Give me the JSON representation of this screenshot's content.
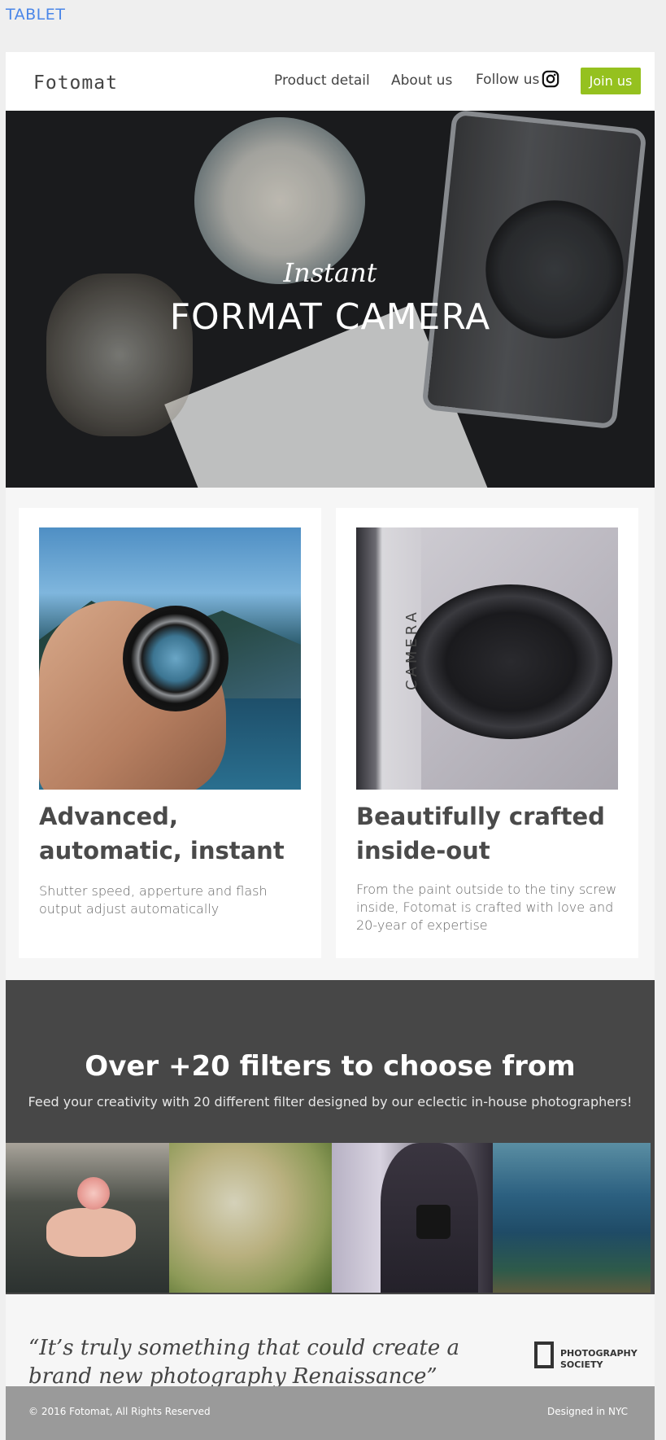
{
  "page_label": "TABLET",
  "header": {
    "logo": "Fotomat",
    "nav": {
      "product": "Product detail",
      "about": "About us",
      "follow": "Follow us"
    },
    "social_icon": "instagram-icon",
    "join_label": "Join us",
    "join_color": "#95c11f"
  },
  "hero": {
    "subtitle": "Instant",
    "title": "FORMAT CAMERA"
  },
  "features": [
    {
      "title": "Advanced, automatic, instant",
      "text": "Shutter speed, apperture and flash output adjust automatically"
    },
    {
      "title": "Beautifully crafted inside-out",
      "text": "From the paint outside to the tiny screw inside, Fotomat is crafted with love and 20-year of expertise",
      "image_text": "CAMERA"
    }
  ],
  "filters": {
    "title": "Over +20 filters to choose from",
    "subtitle": "Feed your creativity with 20 different filter designed by our eclectic in-house photographers!"
  },
  "quote": {
    "text": "“It’s truly something that could create a brand new photography Renaissance”",
    "source_line1": "PHOTOGRAPHY",
    "source_line2": "SOCIETY"
  },
  "footer": {
    "copyright": "© 2016  Fotomat, All Rights Reserved",
    "location": "Designed in NYC"
  }
}
